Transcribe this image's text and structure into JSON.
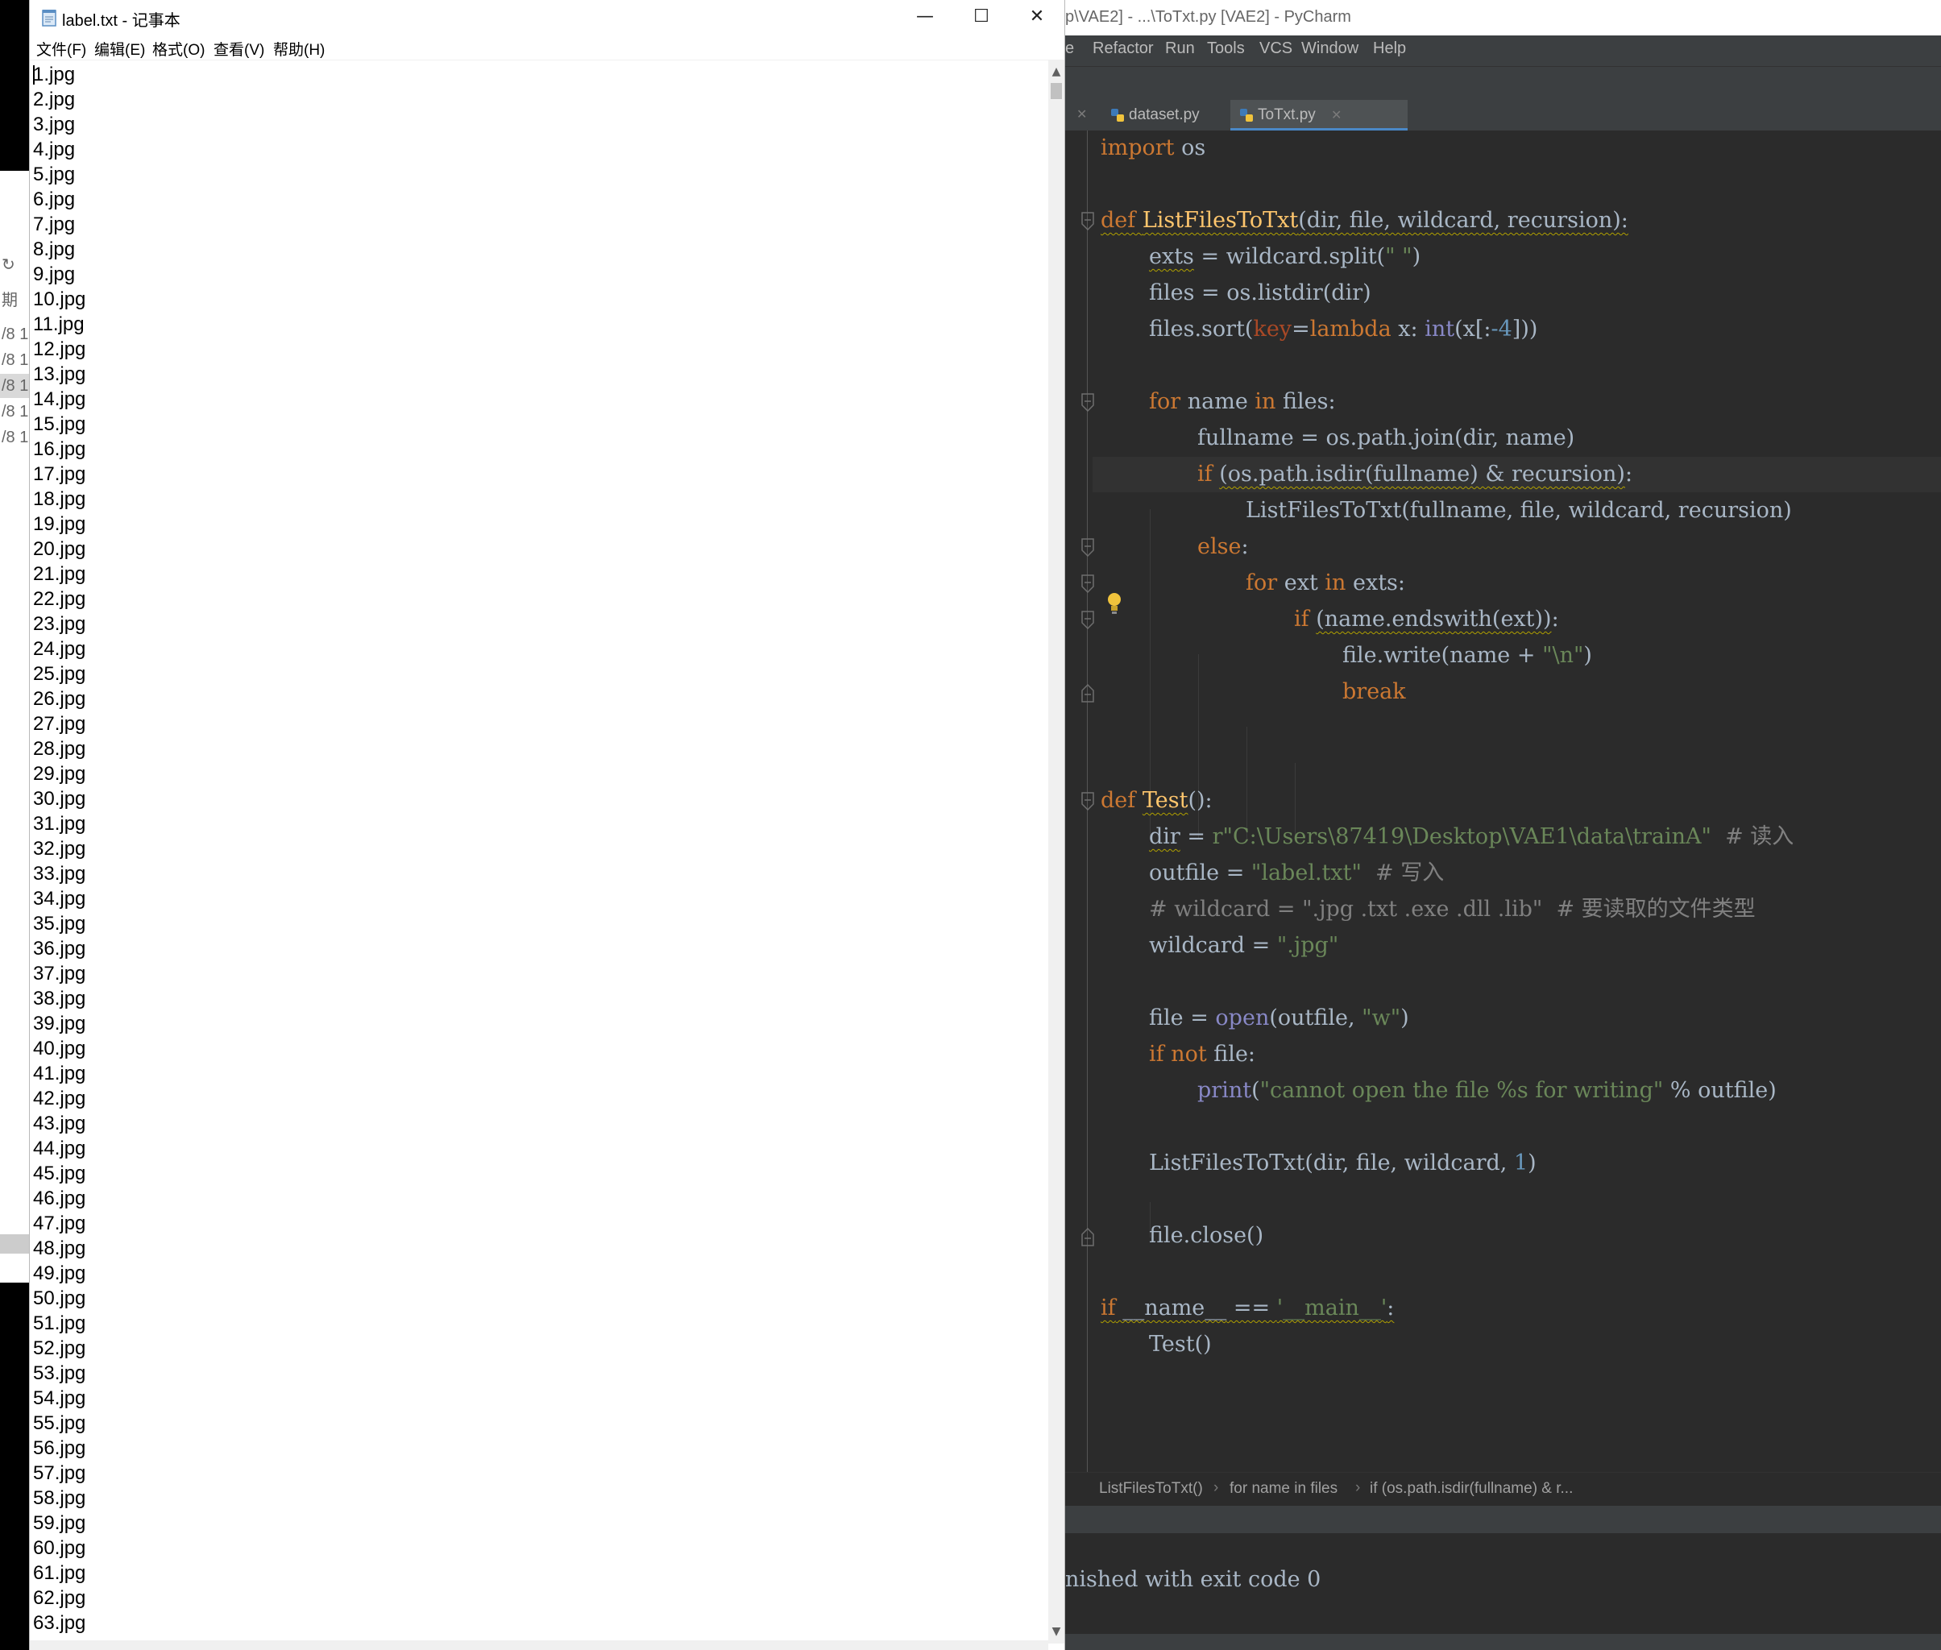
{
  "background": {
    "explorer_date_fragments": [
      "/8 1",
      "/8 1",
      "/8 1",
      "/8 1",
      "/8 1"
    ],
    "explorer_char": "期",
    "explorer_refresh_glyph": "↻"
  },
  "pycharm": {
    "title": "p\\VAE2] - ...\\ToTxt.py [VAE2] - PyCharm",
    "menu": [
      "e",
      "Refactor",
      "Run",
      "Tools",
      "VCS",
      "Window",
      "Help"
    ],
    "tabs": [
      {
        "label": "dataset.py",
        "active": false
      },
      {
        "label": "ToTxt.py",
        "active": true
      }
    ],
    "breadcrumb": [
      "ListFilesToTxt()",
      "for name in files",
      "if (os.path.isdir(fullname) & r..."
    ],
    "breadcrumb_separator": "›",
    "console": "nished with exit code 0",
    "colors": {
      "keyword": "#cc7832",
      "function": "#ffc66d",
      "string": "#6a8759",
      "number": "#6897bb",
      "comment": "#808080",
      "builtin": "#8888c6",
      "text": "#a9b7c6",
      "background": "#2b2b2b",
      "tab_accent": "#4a88c7"
    },
    "code": {
      "l1_kw": "import",
      "l1_rest": " os",
      "l3_kw": "def ",
      "l3_fn": "ListFilesToTxt",
      "l3_rest": "(dir, file, wildcard, recursion):",
      "l4_var": "exts",
      "l4_eq": " = wildcard.split(",
      "l4_str": "\" \"",
      "l4_end": ")",
      "l5": "files = os.listdir(dir)",
      "l6_a": "files.sort(",
      "l6_kwarg": "key",
      "l6_eq": "=",
      "l6_lambda": "lambda",
      "l6_x": " x: ",
      "l6_int": "int",
      "l6_b": "(x[:",
      "l6_num": "-4",
      "l6_c": "]))",
      "l8_for": "for",
      "l8_mid": " name ",
      "l8_in": "in",
      "l8_end": " files:",
      "l9": "fullname = os.path.join(dir, name)",
      "l10_if": "if",
      "l10_cond": "(os.path.isdir(fullname) & recursion)",
      "l10_colon": ":",
      "l11": "ListFilesToTxt(fullname, file, wildcard, recursion)",
      "l12_else": "else",
      "l12_colon": ":",
      "l13_for": "for",
      "l13_mid": " ext ",
      "l13_in": "in",
      "l13_end": " exts:",
      "l14_if": "if",
      "l14_cond": "(name.endswith(ext))",
      "l14_colon": ":",
      "l15_a": "file.write(name + ",
      "l15_str": "\"\\n\"",
      "l15_end": ")",
      "l16_break": "break",
      "l19_def": "def ",
      "l19_fn": "Test",
      "l19_rest": "():",
      "l20_var": "dir",
      "l20_eq": " = ",
      "l20_str": "r\"C:\\Users\\87419\\Desktop\\VAE1\\data\\trainA\"",
      "l20_cm": "  # 读入",
      "l21_a": "outfile = ",
      "l21_str": "\"label.txt\"",
      "l21_cm": "  # 写入",
      "l22_cm": "# wildcard = \".jpg .txt .exe .dll .lib\"  # 要读取的文件类型",
      "l23_a": "wildcard = ",
      "l23_str": "\".jpg\"",
      "l25_a": "file = ",
      "l25_open": "open",
      "l25_b": "(outfile, ",
      "l25_str": "\"w\"",
      "l25_end": ")",
      "l26_if": "if",
      "l26_not": " not",
      "l26_end": " file:",
      "l27_print": "print",
      "l27_a": "(",
      "l27_str": "\"cannot open the file %s for writing\"",
      "l27_end": " % outfile)",
      "l29_a": "ListFilesToTxt(dir, file, wildcard, ",
      "l29_num": "1",
      "l29_end": ")",
      "l31": "file.close()",
      "l33_if": "if",
      "l33_name": " __name__",
      "l33_eq": " == ",
      "l33_str": "'__main__'",
      "l33_colon": ":",
      "l34": "Test()"
    }
  },
  "notepad": {
    "title": "label.txt - 记事本",
    "menu": [
      "文件(F)",
      "编辑(E)",
      "格式(O)",
      "查看(V)",
      "帮助(H)"
    ],
    "window_buttons": {
      "minimize": "—",
      "maximize": "☐",
      "close": "✕"
    },
    "scroll_up": "▲",
    "scroll_down": "▼",
    "lines": [
      "1.jpg",
      "2.jpg",
      "3.jpg",
      "4.jpg",
      "5.jpg",
      "6.jpg",
      "7.jpg",
      "8.jpg",
      "9.jpg",
      "10.jpg",
      "11.jpg",
      "12.jpg",
      "13.jpg",
      "14.jpg",
      "15.jpg",
      "16.jpg",
      "17.jpg",
      "18.jpg",
      "19.jpg",
      "20.jpg",
      "21.jpg",
      "22.jpg",
      "23.jpg",
      "24.jpg",
      "25.jpg",
      "26.jpg",
      "27.jpg",
      "28.jpg",
      "29.jpg",
      "30.jpg",
      "31.jpg",
      "32.jpg",
      "33.jpg",
      "34.jpg",
      "35.jpg",
      "36.jpg",
      "37.jpg",
      "38.jpg",
      "39.jpg",
      "40.jpg",
      "41.jpg",
      "42.jpg",
      "43.jpg",
      "44.jpg",
      "45.jpg",
      "46.jpg",
      "47.jpg",
      "48.jpg",
      "49.jpg",
      "50.jpg",
      "51.jpg",
      "52.jpg",
      "53.jpg",
      "54.jpg",
      "55.jpg",
      "56.jpg",
      "57.jpg",
      "58.jpg",
      "59.jpg",
      "60.jpg",
      "61.jpg",
      "62.jpg",
      "63.jpg"
    ]
  }
}
